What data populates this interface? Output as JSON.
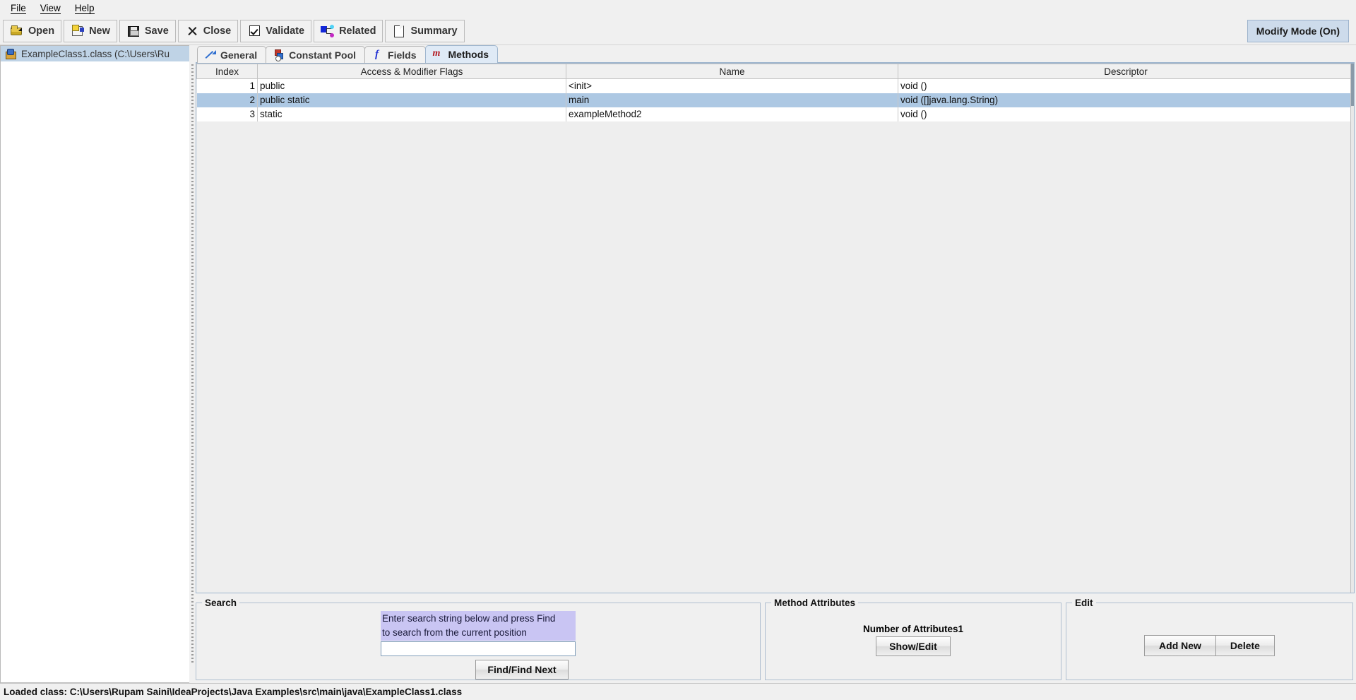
{
  "menubar": {
    "items": [
      {
        "label": "File",
        "mnemonic": "F"
      },
      {
        "label": "View",
        "mnemonic": "V"
      },
      {
        "label": "Help",
        "mnemonic": "H"
      }
    ]
  },
  "toolbar": {
    "buttons": [
      {
        "label": "Open",
        "icon": "open-folder-icon"
      },
      {
        "label": "New",
        "icon": "new-document-icon"
      },
      {
        "label": "Save",
        "icon": "floppy-disk-icon"
      },
      {
        "label": "Close",
        "icon": "close-x-icon"
      },
      {
        "label": "Validate",
        "icon": "checkbox-check-icon"
      },
      {
        "label": "Related",
        "icon": "related-nodes-icon"
      },
      {
        "label": "Summary",
        "icon": "page-summary-icon"
      }
    ],
    "modify_mode_label": "Modify Mode (On)"
  },
  "tree": {
    "items": [
      {
        "label": "ExampleClass1.class (C:\\Users\\Ru",
        "icon": "class-file-icon",
        "selected": true
      }
    ]
  },
  "tabs": [
    {
      "label": "General",
      "icon": "general-arrow-icon",
      "active": false
    },
    {
      "label": "Constant Pool",
      "icon": "constant-pool-icon",
      "active": false
    },
    {
      "label": "Fields",
      "icon": "fields-f-icon",
      "active": false
    },
    {
      "label": "Methods",
      "icon": "methods-m-icon",
      "active": true
    }
  ],
  "methods_table": {
    "columns": [
      "Index",
      "Access & Modifier Flags",
      "Name",
      "Descriptor"
    ],
    "rows": [
      {
        "index": "1",
        "flags": "public",
        "name": "<init>",
        "descriptor": "void ()",
        "selected": false
      },
      {
        "index": "2",
        "flags": "public static",
        "name": "main",
        "descriptor": "void ([]java.lang.String)",
        "selected": true
      },
      {
        "index": "3",
        "flags": "static",
        "name": "exampleMethod2",
        "descriptor": "void ()",
        "selected": false
      }
    ]
  },
  "search_panel": {
    "title": "Search",
    "hint_line1": "Enter search string below and press Find",
    "hint_line2": "to search from the current position",
    "input_value": "",
    "input_placeholder": "",
    "find_button": "Find/Find Next"
  },
  "method_attributes_panel": {
    "title": "Method Attributes",
    "count_label": "Number of Attributes",
    "count_value": "1",
    "show_edit_button": "Show/Edit"
  },
  "edit_panel": {
    "title": "Edit",
    "add_new_button": "Add New",
    "delete_button": "Delete"
  },
  "statusbar": {
    "text": "Loaded class: C:\\Users\\Rupam Saini\\IdeaProjects\\Java Examples\\src\\main\\java\\ExampleClass1.class"
  },
  "colors": {
    "selection_row": "#adc8e3",
    "tree_selection": "#bfd3e6",
    "hint_background": "#c9c5f3",
    "active_tab": "#dfeaf6",
    "modify_mode": "#cddbeb",
    "window_background": "#f0f0f0"
  }
}
